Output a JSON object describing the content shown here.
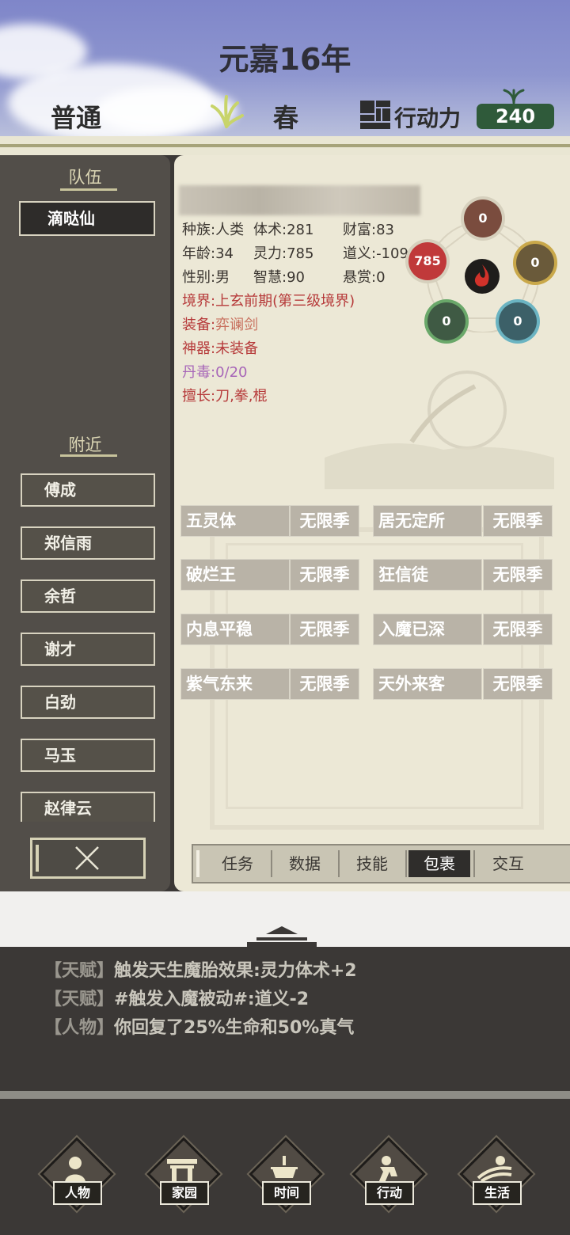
{
  "header": {
    "year": "元嘉16年",
    "difficulty": "普通",
    "season": "春",
    "action_label": "行动力",
    "action_value": "240"
  },
  "left_panel": {
    "team_title": "队伍",
    "team_members": [
      "滴哒仙"
    ],
    "nearby_title": "附近",
    "nearby": [
      "傅成",
      "郑信雨",
      "余哲",
      "谢才",
      "白劲",
      "马玉",
      "赵律云"
    ]
  },
  "character": {
    "row1": [
      "种族:人类",
      "体术:281",
      "财富:83"
    ],
    "row2": [
      "年龄:34",
      "灵力:785",
      "道义:-109"
    ],
    "row3": [
      "性别:男",
      "智慧:90",
      "悬赏:0"
    ],
    "realm": "境界:上玄前期(第三级境界)",
    "equipment": "装备:弈谰剑",
    "artifact": "神器:未装备",
    "pill_toxin": "丹毒:0/20",
    "specialty": "擅长:刀,拳,棍"
  },
  "elements": {
    "top": "0",
    "left": "785",
    "right": "0",
    "bottom_left": "0",
    "bottom_right": "0"
  },
  "talents": [
    {
      "name": "五灵体",
      "duration": "无限季"
    },
    {
      "name": "居无定所",
      "duration": "无限季"
    },
    {
      "name": "破烂王",
      "duration": "无限季"
    },
    {
      "name": "狂信徒",
      "duration": "无限季"
    },
    {
      "name": "内息平稳",
      "duration": "无限季"
    },
    {
      "name": "入魔已深",
      "duration": "无限季"
    },
    {
      "name": "紫气东来",
      "duration": "无限季"
    },
    {
      "name": "天外来客",
      "duration": "无限季"
    }
  ],
  "tabs": [
    "任务",
    "数据",
    "技能",
    "包裹",
    "交互"
  ],
  "active_tab": "包裹",
  "log": [
    {
      "tag": "【天赋】",
      "text": "触发天生魔胎效果:灵力体术+2"
    },
    {
      "tag": "【天赋】",
      "text": "#触发入魔被动#:道义-2"
    },
    {
      "tag": "【人物】",
      "text": "你回复了25%生命和50%真气"
    }
  ],
  "nav": [
    "人物",
    "家园",
    "时间",
    "行动",
    "生活"
  ],
  "colors": {
    "action_badge": "#2f5a3a",
    "realm_text": "#b63a3a",
    "equipment_text": "#c8705e",
    "pill_text": "#a766b8"
  }
}
